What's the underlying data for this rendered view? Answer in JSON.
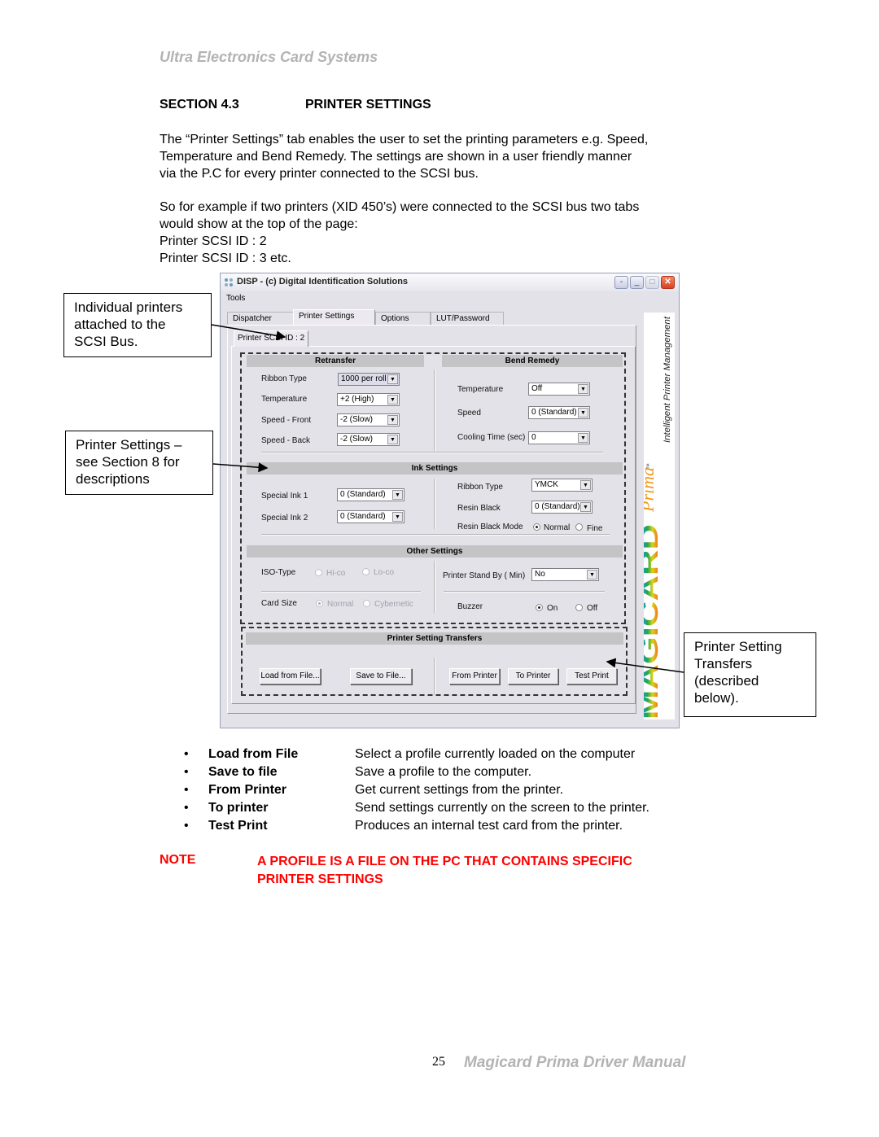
{
  "page_header": "Ultra Electronics Card Systems",
  "section": {
    "number": "SECTION 4.3",
    "title": "PRINTER SETTINGS"
  },
  "paragraph1": [
    "The “Printer Settings” tab enables the user to set the printing parameters e.g. Speed,",
    "Temperature and Bend Remedy. The settings are shown in a user friendly manner",
    "via the P.C for every printer connected to the SCSI bus."
  ],
  "paragraph2": [
    "So for example if two printers (XID 450’s) were connected to the SCSI bus two tabs",
    "would show at the top of the page:",
    "Printer SCSI ID : 2",
    "Printer SCSI ID : 3 etc."
  ],
  "callouts": {
    "scsi": [
      "Individual printers",
      "attached to the",
      "SCSI Bus."
    ],
    "settings": [
      "Printer Settings –",
      "see Section 8 for",
      "descriptions"
    ],
    "transfers": [
      "Printer Setting",
      "Transfers",
      "(described",
      "below)."
    ]
  },
  "window": {
    "title": "DISP - (c) Digital Identification Solutions",
    "controls": {
      "help": "-",
      "minimize": "_",
      "maximize": "□",
      "close": "✕"
    },
    "menu": [
      "Tools"
    ],
    "tabs": [
      "Dispatcher",
      "Printer Settings",
      "Options",
      "LUT/Password"
    ],
    "active_tab": "Printer Settings",
    "subtab": "Printer SCSI ID : 2",
    "retransfer": {
      "title": "Retransfer",
      "fields": [
        {
          "label": "Ribbon Type",
          "value": "1000 per roll"
        },
        {
          "label": "Temperature",
          "value": "+2 (High)"
        },
        {
          "label": "Speed - Front",
          "value": "-2 (Slow)"
        },
        {
          "label": "Speed - Back",
          "value": "-2 (Slow)"
        }
      ]
    },
    "bend_remedy": {
      "title": "Bend Remedy",
      "fields": [
        {
          "label": "Temperature",
          "value": "Off"
        },
        {
          "label": "Speed",
          "value": "0 (Standard)"
        },
        {
          "label": "Cooling Time (sec)",
          "value": "0"
        }
      ]
    },
    "ink_settings": {
      "title": "Ink Settings",
      "left": [
        {
          "label": "Special Ink 1",
          "value": "0 (Standard)"
        },
        {
          "label": "Special Ink 2",
          "value": "0 (Standard)"
        }
      ],
      "right": [
        {
          "label": "Ribbon Type",
          "value": "YMCK"
        },
        {
          "label": "Resin Black",
          "value": "0 (Standard)"
        }
      ],
      "resin_black_mode": {
        "label": "Resin Black Mode",
        "options": [
          "Normal",
          "Fine"
        ],
        "selected": "Normal"
      }
    },
    "other_settings": {
      "title": "Other Settings",
      "iso_type": {
        "label": "ISO-Type",
        "options": [
          "Hi-co",
          "Lo-co"
        ],
        "selected": null,
        "disabled": true
      },
      "card_size": {
        "label": "Card Size",
        "options": [
          "Normal",
          "Cybernetic"
        ],
        "selected": "Normal",
        "disabled": true
      },
      "standby": {
        "label": "Printer Stand By ( Min)",
        "value": "No"
      },
      "buzzer": {
        "label": "Buzzer",
        "options": [
          "On",
          "Off"
        ],
        "selected": "On"
      }
    },
    "transfers": {
      "title": "Printer Setting Transfers",
      "buttons": [
        "Load from File...",
        "Save to File...",
        "From Printer",
        "To Printer",
        "Test Print"
      ]
    },
    "brand": {
      "name": "MAGICARD",
      "product": "Prima",
      "tm": "™",
      "tagline": "Intelligent Printer Management"
    }
  },
  "bullets": [
    {
      "term": "Load from File",
      "desc": "Select a profile currently loaded on the computer"
    },
    {
      "term": "Save to file",
      "desc": "Save a profile to the computer."
    },
    {
      "term": "From Printer",
      "desc": "Get current settings from the printer."
    },
    {
      "term": "To printer",
      "desc": "Send settings currently on the screen to the printer."
    },
    {
      "term": "Test Print",
      "desc": "Produces an internal test card from the printer."
    }
  ],
  "note": {
    "label": "NOTE",
    "lines": [
      "A PROFILE IS A FILE ON THE PC THAT CONTAINS SPECIFIC",
      "PRINTER SETTINGS"
    ]
  },
  "footer": {
    "page_number": "25",
    "title": "Magicard Prima Driver Manual"
  },
  "colors": {
    "header_gray": "#b3b3b3",
    "note_red": "#ff0000",
    "window_bg": "#e3e2e8",
    "band_gray": "#c4c4c6"
  }
}
